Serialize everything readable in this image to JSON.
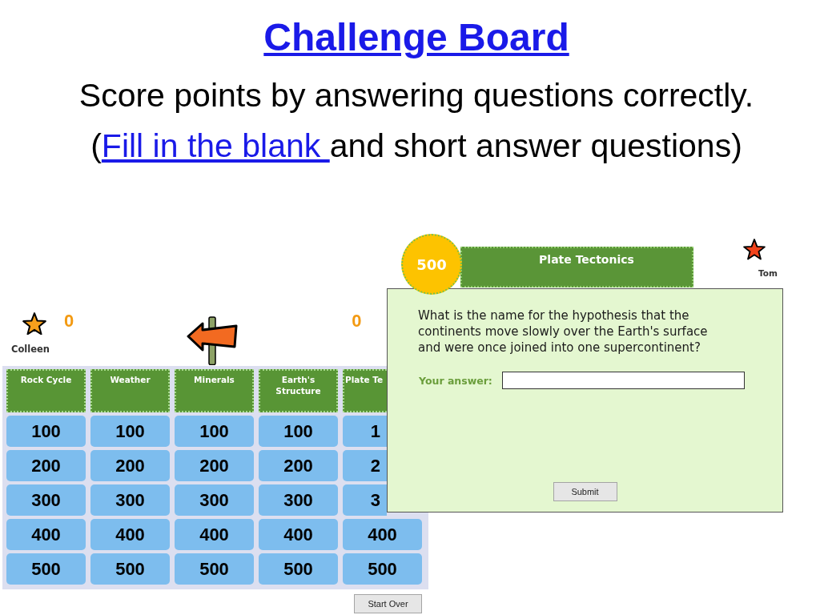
{
  "header": {
    "title": "Challenge Board",
    "subtitle": "Score points by answering questions correctly.",
    "note": {
      "before": "(",
      "link": "Fill in the blank ",
      "after": "and short answer questions)"
    }
  },
  "players": [
    {
      "name": "Colleen",
      "score": "0",
      "color": "#f7a01c"
    },
    {
      "name": "Tom",
      "score": "0",
      "color": "#f2431c"
    }
  ],
  "board": {
    "categories": [
      "Rock Cycle",
      "Weather",
      "Minerals",
      "Earth's Structure",
      "Plate Te"
    ],
    "rows": [
      [
        "100",
        "100",
        "100",
        "100",
        "1"
      ],
      [
        "200",
        "200",
        "200",
        "200",
        "2"
      ],
      [
        "300",
        "300",
        "300",
        "300",
        "3"
      ],
      [
        "400",
        "400",
        "400",
        "400",
        "400"
      ],
      [
        "500",
        "500",
        "500",
        "500",
        "500"
      ]
    ],
    "start_over_button": "Start Over"
  },
  "question_dialog": {
    "points": "500",
    "category": "Plate Tectonics",
    "question": "What is the name for the hypothesis that the continents move slowly over the Earth's surface and were once joined into one supercontinent?",
    "answer_label": "Your answer:",
    "submit_button": "Submit"
  }
}
